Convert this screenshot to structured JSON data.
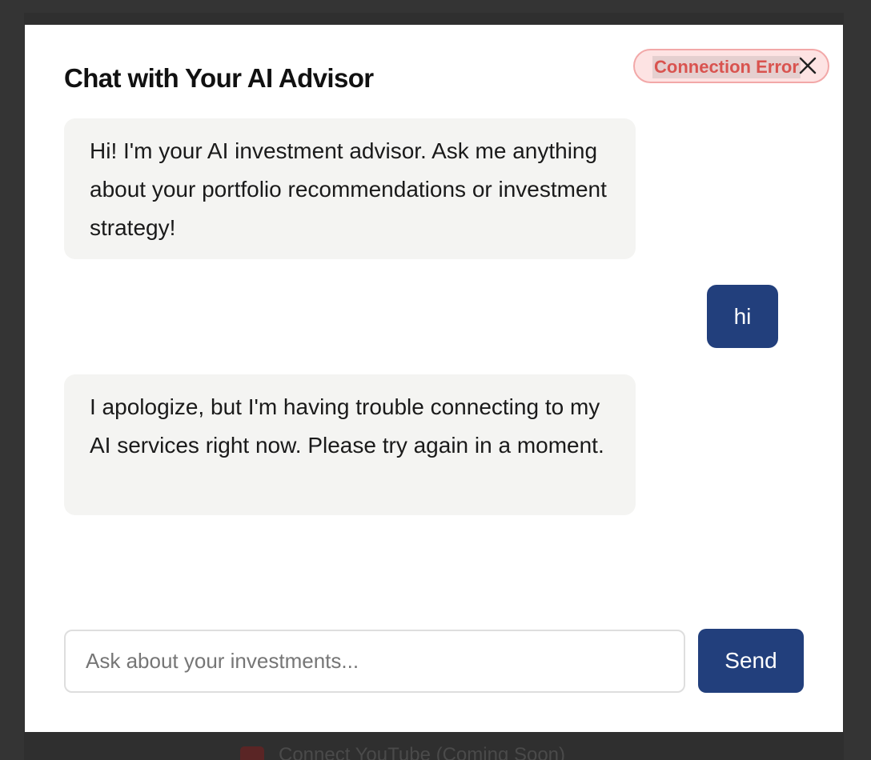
{
  "background_page": {
    "connect_youtube_label": "Connect YouTube (Coming Soon)"
  },
  "chat": {
    "title": "Chat with Your AI Advisor",
    "status_badge": "Connection Error",
    "close_icon": "close-icon",
    "messages": [
      {
        "role": "assistant",
        "text": "Hi! I'm your AI investment advisor. Ask me anything about your portfolio recommendations or investment strategy!"
      },
      {
        "role": "user",
        "text": "hi"
      },
      {
        "role": "assistant",
        "text": "I apologize, but I'm having trouble connecting to my AI services right now. Please try again in a moment."
      }
    ],
    "input": {
      "value": "",
      "placeholder": "Ask about your investments..."
    },
    "send_label": "Send"
  },
  "colors": {
    "accent": "#223f7c",
    "error_text": "#d9534f",
    "error_bg": "#fde3e3",
    "assistant_bubble": "#f4f4f2"
  }
}
